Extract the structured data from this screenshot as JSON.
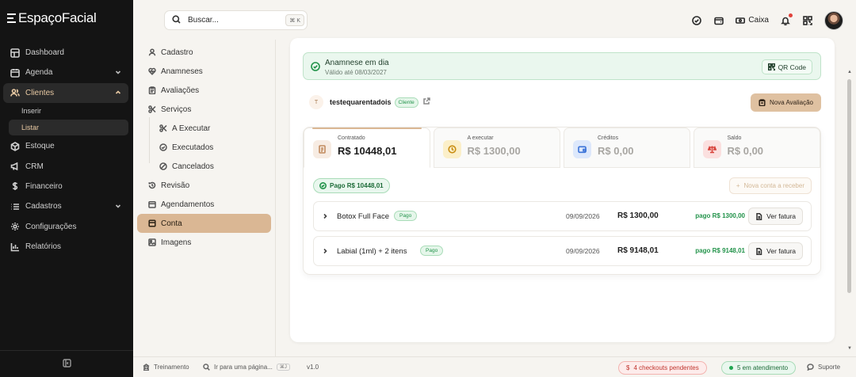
{
  "app": {
    "logo": "EspaçoFacial"
  },
  "sidebar": {
    "items": [
      {
        "label": "Dashboard",
        "icon": "dashboard-icon"
      },
      {
        "label": "Agenda",
        "icon": "calendar-icon"
      },
      {
        "label": "Clientes",
        "icon": "users-icon"
      },
      {
        "label": "Estoque",
        "icon": "box-icon"
      },
      {
        "label": "CRM",
        "icon": "megaphone-icon"
      },
      {
        "label": "Financeiro",
        "icon": "dollar-icon"
      },
      {
        "label": "Cadastros",
        "icon": "list-icon"
      },
      {
        "label": "Configurações",
        "icon": "gear-icon"
      },
      {
        "label": "Relatórios",
        "icon": "chart-icon"
      }
    ],
    "clientes_sub": [
      "Inserir",
      "Listar"
    ]
  },
  "search": {
    "placeholder": "Buscar...",
    "shortcut": "⌘ K"
  },
  "topbar": {
    "caixa_label": "Caixa"
  },
  "submenu": {
    "items": [
      "Cadastro",
      "Anamneses",
      "Avaliações",
      "Serviços",
      "A Executar",
      "Executados",
      "Cancelados",
      "Revisão",
      "Agendamentos",
      "Conta",
      "Imagens"
    ]
  },
  "banner": {
    "title": "Anamnese em dia",
    "subtitle": "Válido até 08/03/2027",
    "qr_label": "QR Code"
  },
  "client": {
    "initial": "T",
    "name": "testequarentadois",
    "badge": "Cliente",
    "new_eval_label": "Nova Avaliação"
  },
  "stats": [
    {
      "label": "Contratado",
      "value": "R$ 10448,01"
    },
    {
      "label": "A executar",
      "value": "R$ 1300,00"
    },
    {
      "label": "Créditos",
      "value": "R$ 0,00"
    },
    {
      "label": "Saldo",
      "value": "R$ 0,00"
    }
  ],
  "account": {
    "paid_pill": "Pago R$ 10448,01",
    "new_account_label": "Nova conta a receber"
  },
  "rows": [
    {
      "desc": "Botox Full Face",
      "badge": "Pago",
      "date": "09/09/2026",
      "amount": "R$ 1300,00",
      "paid": "pago R$ 1300,00",
      "action": "Ver fatura"
    },
    {
      "desc": "Labial (1ml) + 2 itens",
      "badge": "Pago",
      "date": "09/09/2026",
      "amount": "R$ 9148,01",
      "paid": "pago R$ 9148,01",
      "action": "Ver fatura"
    }
  ],
  "footer": {
    "training": "Treinamento",
    "goto": "Ir para uma página...",
    "goto_kbd": "⌘J",
    "version": "v1.0",
    "checkouts": "4 checkouts pendentes",
    "attendance": "5 em atendimento",
    "support": "Suporte"
  },
  "colors": {
    "accent": "#dab794",
    "success": "#22934a",
    "danger": "#c0342d",
    "sidebar_bg": "#141414"
  }
}
